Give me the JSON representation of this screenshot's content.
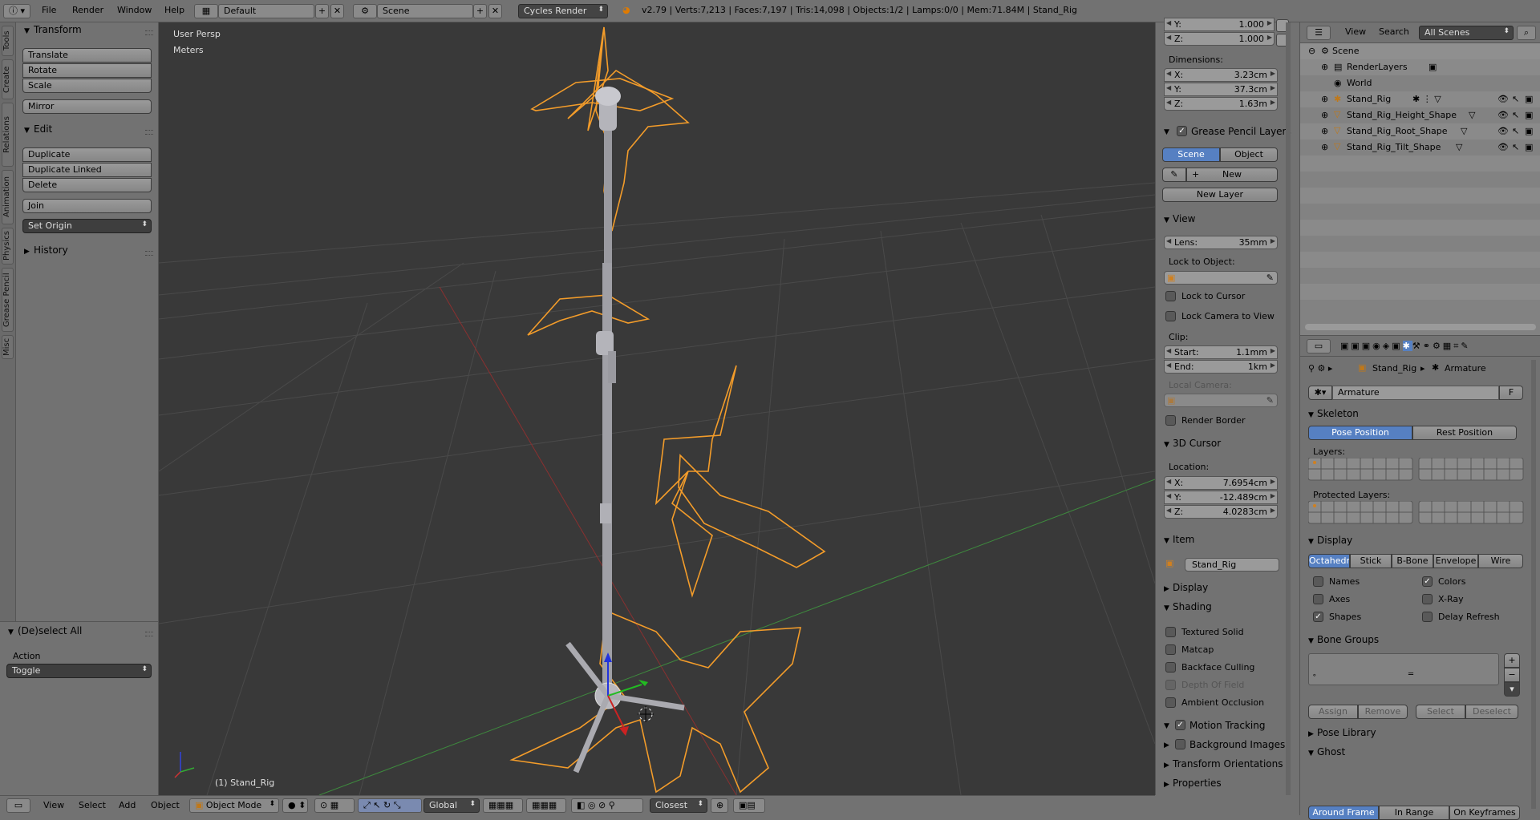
{
  "topbar": {
    "menus": [
      "File",
      "Render",
      "Window",
      "Help"
    ],
    "layout": "Default",
    "scene": "Scene",
    "engine": "Cycles Render",
    "stats": "v2.79 | Verts:7,213 | Faces:7,197 | Tris:14,098 | Objects:1/2 | Lamps:0/0 | Mem:71.84M | Stand_Rig"
  },
  "tabs": [
    "Tools",
    "Create",
    "Relations",
    "Animation",
    "Physics",
    "Grease Pencil",
    "Misc"
  ],
  "toolshelf": {
    "transform_title": "Transform",
    "transform_buttons": [
      "Translate",
      "Rotate",
      "Scale"
    ],
    "mirror": "Mirror",
    "edit_title": "Edit",
    "edit_buttons": [
      "Duplicate",
      "Duplicate Linked",
      "Delete"
    ],
    "join": "Join",
    "set_origin": "Set Origin",
    "history_title": "History"
  },
  "operator": {
    "title": "(De)select All",
    "action_label": "Action",
    "action_value": "Toggle"
  },
  "viewport": {
    "view_name": "User Persp",
    "units": "Meters",
    "object_label": "(1) Stand_Rig"
  },
  "npanel": {
    "scale_y": {
      "label": "Y:",
      "value": "1.000"
    },
    "scale_z": {
      "label": "Z:",
      "value": "1.000"
    },
    "dimensions_label": "Dimensions:",
    "dim_x": {
      "label": "X:",
      "value": "3.23cm"
    },
    "dim_y": {
      "label": "Y:",
      "value": "37.3cm"
    },
    "dim_z": {
      "label": "Z:",
      "value": "1.63m"
    },
    "grease_title": "Grease Pencil Layers",
    "grease_scene": "Scene",
    "grease_object": "Object",
    "grease_new": "New",
    "grease_new_layer": "New Layer",
    "view_title": "View",
    "lens": {
      "label": "Lens:",
      "value": "35mm"
    },
    "lock_to_object": "Lock to Object:",
    "lock_cursor": "Lock to Cursor",
    "lock_camera": "Lock Camera to View",
    "clip_label": "Clip:",
    "clip_start": {
      "label": "Start:",
      "value": "1.1mm"
    },
    "clip_end": {
      "label": "End:",
      "value": "1km"
    },
    "local_camera": "Local Camera:",
    "render_border": "Render Border",
    "cursor_title": "3D Cursor",
    "location_label": "Location:",
    "cur_x": {
      "label": "X:",
      "value": "7.6954cm"
    },
    "cur_y": {
      "label": "Y:",
      "value": "-12.489cm"
    },
    "cur_z": {
      "label": "Z:",
      "value": "4.0283cm"
    },
    "item_title": "Item",
    "item_name": "Stand_Rig",
    "display_title": "Display",
    "shading_title": "Shading",
    "shading_opts": [
      "Textured Solid",
      "Matcap",
      "Backface Culling",
      "Depth Of Field",
      "Ambient Occlusion"
    ],
    "motion_tracking": "Motion Tracking",
    "background_images": "Background Images",
    "transform_orient": "Transform Orientations",
    "properties": "Properties"
  },
  "outliner": {
    "menus": [
      "View",
      "Search"
    ],
    "filter": "All Scenes",
    "rows": [
      "Scene",
      "RenderLayers",
      "World",
      "Stand_Rig",
      "Stand_Rig_Height_Shape",
      "Stand_Rig_Root_Shape",
      "Stand_Rig_Tilt_Shape"
    ]
  },
  "props": {
    "crumb_object": "Stand_Rig",
    "crumb_data": "Armature",
    "datablock": "Armature",
    "datablock_f": "F",
    "skeleton_title": "Skeleton",
    "pose_position": "Pose Position",
    "rest_position": "Rest Position",
    "layers_label": "Layers:",
    "protected_label": "Protected Layers:",
    "display_title": "Display",
    "display_modes": [
      "Octahedr",
      "Stick",
      "B-Bone",
      "Envelope",
      "Wire"
    ],
    "names": "Names",
    "colors": "Colors",
    "axes": "Axes",
    "xray": "X-Ray",
    "shapes": "Shapes",
    "delay_refresh": "Delay Refresh",
    "bone_groups_title": "Bone Groups",
    "assign": "Assign",
    "remove": "Remove",
    "select": "Select",
    "deselect": "Deselect",
    "pose_library_title": "Pose Library",
    "ghost_title": "Ghost",
    "ghost_modes": [
      "Around Frame",
      "In Range",
      "On Keyframes"
    ]
  },
  "bottombar": {
    "menus": [
      "View",
      "Select",
      "Add",
      "Object"
    ],
    "mode": "Object Mode",
    "orientation": "Global",
    "snap": "Closest"
  },
  "colors": {
    "accent": "#5680c2",
    "wire": "#f39c2a",
    "viewport_bg": "#393939"
  }
}
